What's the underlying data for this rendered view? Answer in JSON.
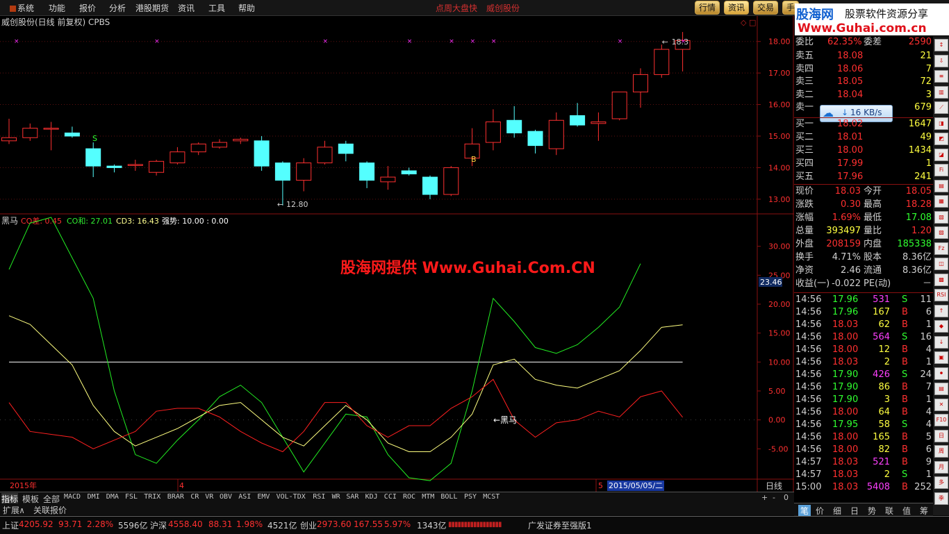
{
  "menu": {
    "items": [
      "系统",
      "功能",
      "报价",
      "分析",
      "港股期货",
      "资讯",
      "工具",
      "帮助"
    ],
    "center": [
      "点周大盘快",
      "威创股份"
    ],
    "right_buttons": [
      "行情",
      "资讯",
      "交易",
      "手"
    ]
  },
  "banner": {
    "logo": "股海网",
    "slogan": "股票软件资源分享",
    "url": "Www.Guhai.com.cn"
  },
  "chart": {
    "title": "威创股份(日线 前复权) CPBS",
    "price_ticks": [
      "18.00",
      "17.00",
      "16.00",
      "15.00",
      "14.00",
      "13.00"
    ],
    "high_label": "18.3",
    "low_label": "12.80",
    "s_marker": "S",
    "b_marker": "B",
    "indicator_header": {
      "name": "黑马",
      "co_diff": "CO差: 0.45",
      "co_sum": "CO和: 27.01",
      "cd3": "CD3: 16.43",
      "strength": "强势: 10.00 : 0.00"
    },
    "indicator_ticks": [
      "30.00",
      "25.00",
      "20.00",
      "15.00",
      "10.00",
      "5.00",
      "0.00",
      "-5.00"
    ],
    "current_value": "23.46",
    "heima_label": "黑马",
    "watermark": "股海网提供 Www.Guhai.Com.CN",
    "date_axis": {
      "year": "2015年",
      "month4": "4",
      "month5": "5",
      "cursor_date": "2015/05/05/二",
      "period": "日线"
    },
    "colors": {
      "up": "#ff3030",
      "down": "#54ffff",
      "co_diff": "#ff2020",
      "co_sum": "#22ee22",
      "cd3": "#ffff80",
      "strength": "#ffffff"
    }
  },
  "chart_data": {
    "type": "candlestick",
    "candles": [
      {
        "o": 14.85,
        "h": 15.55,
        "l": 14.75,
        "c": 14.95
      },
      {
        "o": 14.95,
        "h": 15.4,
        "l": 14.85,
        "c": 15.25
      },
      {
        "o": 15.25,
        "h": 15.45,
        "l": 14.55,
        "c": 15.25
      },
      {
        "o": 15.1,
        "h": 15.3,
        "l": 14.95,
        "c": 15.0
      },
      {
        "o": 14.6,
        "h": 14.8,
        "l": 13.7,
        "c": 14.05
      },
      {
        "o": 14.05,
        "h": 14.1,
        "l": 13.85,
        "c": 14.0
      },
      {
        "o": 14.1,
        "h": 14.25,
        "l": 13.9,
        "c": 14.1
      },
      {
        "o": 13.85,
        "h": 14.25,
        "l": 13.75,
        "c": 14.2
      },
      {
        "o": 14.15,
        "h": 14.65,
        "l": 14.1,
        "c": 14.5
      },
      {
        "o": 14.5,
        "h": 14.8,
        "l": 14.4,
        "c": 14.75
      },
      {
        "o": 14.65,
        "h": 14.9,
        "l": 14.6,
        "c": 14.8
      },
      {
        "o": 14.85,
        "h": 14.95,
        "l": 14.75,
        "c": 14.9
      },
      {
        "o": 14.85,
        "h": 15.0,
        "l": 13.9,
        "c": 14.05
      },
      {
        "o": 14.15,
        "h": 14.2,
        "l": 12.8,
        "c": 13.6
      },
      {
        "o": 13.6,
        "h": 14.3,
        "l": 13.25,
        "c": 14.15
      },
      {
        "o": 14.15,
        "h": 14.85,
        "l": 14.1,
        "c": 14.65
      },
      {
        "o": 14.75,
        "h": 14.85,
        "l": 14.2,
        "c": 14.45
      },
      {
        "o": 14.15,
        "h": 14.2,
        "l": 13.35,
        "c": 13.6
      },
      {
        "o": 13.55,
        "h": 14.05,
        "l": 13.3,
        "c": 13.7
      },
      {
        "o": 13.9,
        "h": 14.0,
        "l": 13.75,
        "c": 13.8
      },
      {
        "o": 13.7,
        "h": 13.75,
        "l": 13.0,
        "c": 13.15
      },
      {
        "o": 13.15,
        "h": 14.05,
        "l": 13.1,
        "c": 14.0
      },
      {
        "o": 14.3,
        "h": 15.25,
        "l": 14.05,
        "c": 14.75
      },
      {
        "o": 14.8,
        "h": 15.85,
        "l": 14.55,
        "c": 15.45
      },
      {
        "o": 15.5,
        "h": 15.95,
        "l": 14.95,
        "c": 15.1
      },
      {
        "o": 15.15,
        "h": 15.2,
        "l": 14.45,
        "c": 14.7
      },
      {
        "o": 14.6,
        "h": 15.75,
        "l": 14.4,
        "c": 15.5
      },
      {
        "o": 15.65,
        "h": 16.05,
        "l": 15.3,
        "c": 15.35
      },
      {
        "o": 15.4,
        "h": 15.75,
        "l": 14.85,
        "c": 15.45
      },
      {
        "o": 15.55,
        "h": 16.35,
        "l": 15.5,
        "c": 16.4
      },
      {
        "o": 16.4,
        "h": 17.15,
        "l": 15.9,
        "c": 16.95
      },
      {
        "o": 16.95,
        "h": 17.9,
        "l": 16.85,
        "c": 17.75
      },
      {
        "o": 17.75,
        "h": 18.3,
        "l": 17.05,
        "c": 18.03
      }
    ],
    "top_markers_index": [
      0,
      7,
      15,
      19,
      21,
      22,
      23,
      29,
      32
    ],
    "ylim": [
      12.6,
      18.5
    ],
    "indicator": {
      "ylim": [
        -10,
        35
      ],
      "co_diff": [
        3,
        -2,
        -2.5,
        -3,
        -5,
        -3.5,
        -2,
        1.5,
        2,
        2,
        0.5,
        -2,
        -4,
        -5.5,
        -2,
        3,
        3,
        -1,
        -3,
        -1,
        -1,
        2,
        4,
        7,
        0,
        -3,
        -0.5,
        0,
        1.5,
        0.5,
        4,
        5,
        0.45
      ],
      "co_sum": [
        26,
        34,
        35,
        28,
        21,
        5,
        -6,
        -7.5,
        -3.5,
        0,
        4,
        6,
        3,
        -3,
        -9,
        -4,
        1,
        0.5,
        -6,
        -10,
        -10.5,
        -7.5,
        5,
        21,
        17,
        12.5,
        11.5,
        13,
        16,
        19.5,
        27
      ],
      "cd3": [
        18,
        16.5,
        13,
        9.5,
        2.5,
        -2,
        -4.5,
        -3,
        -1.5,
        0.5,
        2.5,
        3,
        0,
        -3,
        -4.5,
        -1,
        2.5,
        0,
        -4,
        -5.5,
        -5.5,
        -3,
        1,
        9.5,
        10.5,
        7,
        6,
        5.5,
        7,
        8.5,
        12,
        16,
        16.43
      ],
      "strength": 10
    }
  },
  "quote": {
    "weibi": {
      "label": "委比",
      "val": "62.35%",
      "label2": "委差",
      "val2": "2590"
    },
    "sells": [
      {
        "label": "卖五",
        "price": "18.08",
        "vol": "21"
      },
      {
        "label": "卖四",
        "price": "18.06",
        "vol": "7"
      },
      {
        "label": "卖三",
        "price": "18.05",
        "vol": "72"
      },
      {
        "label": "卖二",
        "price": "18.04",
        "vol": "3"
      },
      {
        "label": "卖一",
        "price": "",
        "vol": "679"
      }
    ],
    "speed": "16 KB/s",
    "buys": [
      {
        "label": "买一",
        "price": "18.02",
        "vol": "1647"
      },
      {
        "label": "买二",
        "price": "18.01",
        "vol": "49"
      },
      {
        "label": "买三",
        "price": "18.00",
        "vol": "1434"
      },
      {
        "label": "买四",
        "price": "17.99",
        "vol": "1"
      },
      {
        "label": "买五",
        "price": "17.96",
        "vol": "241"
      }
    ],
    "stats": [
      {
        "l1": "现价",
        "v1": "18.03",
        "l2": "今开",
        "v2": "18.05"
      },
      {
        "l1": "涨跌",
        "v1": "0.30",
        "l2": "最高",
        "v2": "18.28"
      },
      {
        "l1": "涨幅",
        "v1": "1.69%",
        "l2": "最低",
        "v2": "17.08"
      },
      {
        "l1": "总量",
        "v1": "393497",
        "l2": "量比",
        "v2": "1.20"
      },
      {
        "l1": "外盘",
        "v1": "208159",
        "l2": "内盘",
        "v2": "185338"
      },
      {
        "l1": "换手",
        "v1": "4.71%",
        "l2": "股本",
        "v2": "8.36亿"
      },
      {
        "l1": "净资",
        "v1": "2.46",
        "l2": "流通",
        "v2": "8.36亿"
      },
      {
        "l1": "收益(一)",
        "v1": "-0.022",
        "l2": "PE(动)",
        "v2": "－"
      }
    ],
    "ticks": [
      {
        "t": "14:56",
        "p": "17.96",
        "v": "531",
        "s": "S",
        "n": "11"
      },
      {
        "t": "14:56",
        "p": "17.96",
        "v": "167",
        "s": "B",
        "n": "6"
      },
      {
        "t": "14:56",
        "p": "18.03",
        "v": "62",
        "s": "B",
        "n": "1"
      },
      {
        "t": "14:56",
        "p": "18.00",
        "v": "564",
        "s": "S",
        "n": "16"
      },
      {
        "t": "14:56",
        "p": "18.00",
        "v": "12",
        "s": "B",
        "n": "4"
      },
      {
        "t": "14:56",
        "p": "18.03",
        "v": "2",
        "s": "B",
        "n": "1"
      },
      {
        "t": "14:56",
        "p": "17.90",
        "v": "426",
        "s": "S",
        "n": "24"
      },
      {
        "t": "14:56",
        "p": "17.90",
        "v": "86",
        "s": "B",
        "n": "7"
      },
      {
        "t": "14:56",
        "p": "17.90",
        "v": "3",
        "s": "B",
        "n": "1"
      },
      {
        "t": "14:56",
        "p": "18.00",
        "v": "64",
        "s": "B",
        "n": "4"
      },
      {
        "t": "14:56",
        "p": "17.95",
        "v": "58",
        "s": "S",
        "n": "4"
      },
      {
        "t": "14:56",
        "p": "18.00",
        "v": "165",
        "s": "B",
        "n": "5"
      },
      {
        "t": "14:56",
        "p": "18.00",
        "v": "82",
        "s": "B",
        "n": "6"
      },
      {
        "t": "14:57",
        "p": "18.03",
        "v": "521",
        "s": "B",
        "n": "9"
      },
      {
        "t": "14:57",
        "p": "18.03",
        "v": "2",
        "s": "S",
        "n": "1"
      },
      {
        "t": "15:00",
        "p": "18.03",
        "v": "5408",
        "s": "B",
        "n": "252"
      }
    ]
  },
  "indicator_tabs": [
    "指标",
    "模板",
    "全部",
    "MACD",
    "DMI",
    "DMA",
    "FSL",
    "TRIX",
    "BRAR",
    "CR",
    "VR",
    "OBV",
    "ASI",
    "EMV",
    "VOL-TDX",
    "RSI",
    "WR",
    "SAR",
    "KDJ",
    "CCI",
    "ROC",
    "MTM",
    "BOLL",
    "PSY",
    "MCST"
  ],
  "zoom_buttons": [
    "+",
    "-",
    "0"
  ],
  "sub_tabs": [
    "扩展∧",
    "关联报价"
  ],
  "side_tabs": [
    "笔",
    "价",
    "细",
    "日",
    "势",
    "联",
    "值",
    "筹"
  ],
  "right_icons": [
    "↕",
    "⇩",
    "≡",
    "▥",
    "⟋",
    "◨",
    "◩",
    "◪",
    "Fi",
    "▤",
    "▦",
    "▧",
    "▨",
    "Fz",
    "◫",
    "▩",
    "RSI",
    "↑",
    "◆",
    "↓",
    "▣",
    "⚫",
    "▤",
    "✕",
    "F10",
    "日",
    "周",
    "月",
    "多",
    "季"
  ],
  "status": {
    "sh": {
      "label": "上证",
      "val": "4205.92",
      "chg": "93.71",
      "pct": "2.28%",
      "amt": "5596亿"
    },
    "hs": {
      "label": "沪深",
      "val": "4558.40",
      "chg": "88.31",
      "pct": "1.98%",
      "amt": "4521亿"
    },
    "cy": {
      "label": "创业",
      "val": "2973.60",
      "chg": "167.55",
      "pct": "5.97%",
      "amt": "1343亿"
    },
    "broker": "广发证券至强版1"
  }
}
